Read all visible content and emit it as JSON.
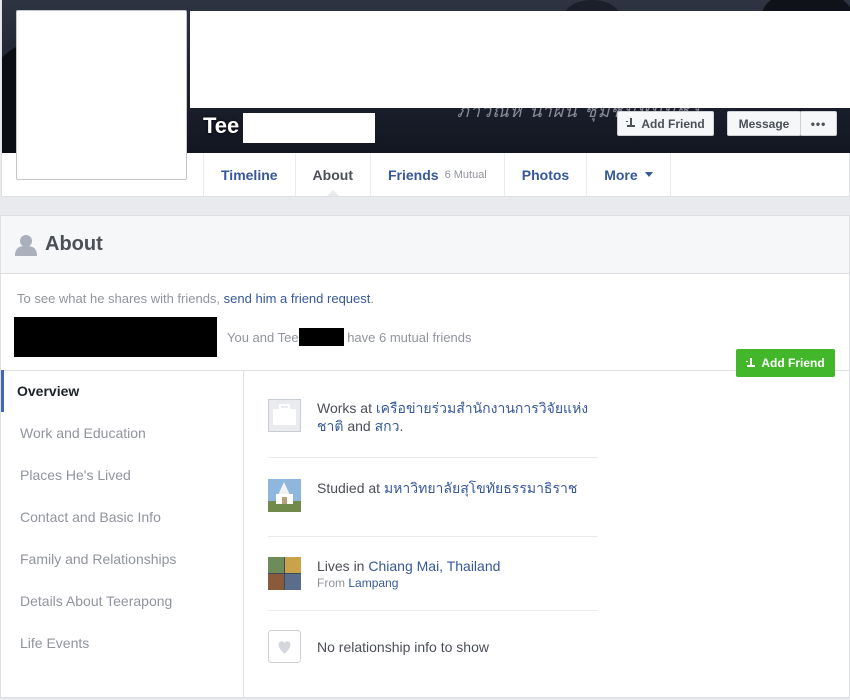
{
  "profile": {
    "name_visible": "Tee",
    "cover_script": "ภาวิณีห์ นำผืน ชุมชนหนุนชัง"
  },
  "header_buttons": {
    "add_friend": "Add Friend",
    "message": "Message",
    "more": "•••"
  },
  "tabs": [
    {
      "label": "Timeline"
    },
    {
      "label": "About"
    },
    {
      "label": "Friends",
      "sub": "6 Mutual"
    },
    {
      "label": "Photos"
    },
    {
      "label": "More"
    }
  ],
  "about": {
    "title": "About",
    "prompt_prefix": "To see what he shares with friends, ",
    "prompt_link": "send him a friend request",
    "prompt_suffix": ".",
    "add_friend": "Add Friend",
    "mutual_prefix": "You and Tee",
    "mutual_suffix": "have 6 mutual friends"
  },
  "sidebar": {
    "items": [
      {
        "label": "Overview"
      },
      {
        "label": "Work and Education"
      },
      {
        "label": "Places He's Lived"
      },
      {
        "label": "Contact and Basic Info"
      },
      {
        "label": "Family and Relationships"
      },
      {
        "label": "Details About Teerapong"
      },
      {
        "label": "Life Events"
      }
    ]
  },
  "overview": {
    "work": {
      "prefix": "Works at ",
      "link1": "เครือข่ายร่วมสำนักงานการวิจัยแห่งชาติ",
      "mid": " and ",
      "link2": "สกว",
      "suffix": "."
    },
    "study": {
      "prefix": "Studied at ",
      "link": "มหาวิทยาลัยสุโขทัยธรรมาธิราช"
    },
    "lives": {
      "prefix": "Lives in ",
      "link": "Chiang Mai, Thailand",
      "from_prefix": "From ",
      "from_link": "Lampang"
    },
    "relationship": {
      "text": "No relationship info to show"
    }
  },
  "colors": {
    "link": "#365899",
    "green": "#42b72a",
    "muted": "#90949c",
    "accent": "#4267b2"
  }
}
